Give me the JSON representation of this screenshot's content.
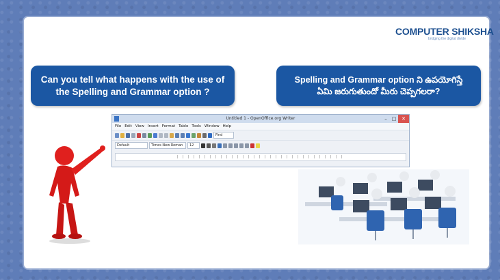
{
  "logo": {
    "title": "COMPUTER SHIKSHA",
    "tagline": "bridging the digital divide"
  },
  "question_english": "Can you tell what happens with the use of the Spelling and Grammar option ?",
  "question_telugu": "Spelling and Grammar option ని ఉపయోగిస్తే ఏమి జరుగుతుందో మీరు చెప్పగలరా?",
  "writer_window": {
    "title": "Untitled 1 - OpenOffice.org Writer",
    "menu": [
      "File",
      "Edit",
      "View",
      "Insert",
      "Format",
      "Table",
      "Tools",
      "Window",
      "Help"
    ],
    "paragraph_style": "Default",
    "font_name": "Times New Roman",
    "font_size": "12",
    "find_box": "Find",
    "controls": {
      "minimize": "–",
      "maximize": "□",
      "close": "✕"
    }
  },
  "colors": {
    "bubble": "#1b57a3",
    "background": "#5f7db8",
    "logo": "#1c4f8f"
  }
}
